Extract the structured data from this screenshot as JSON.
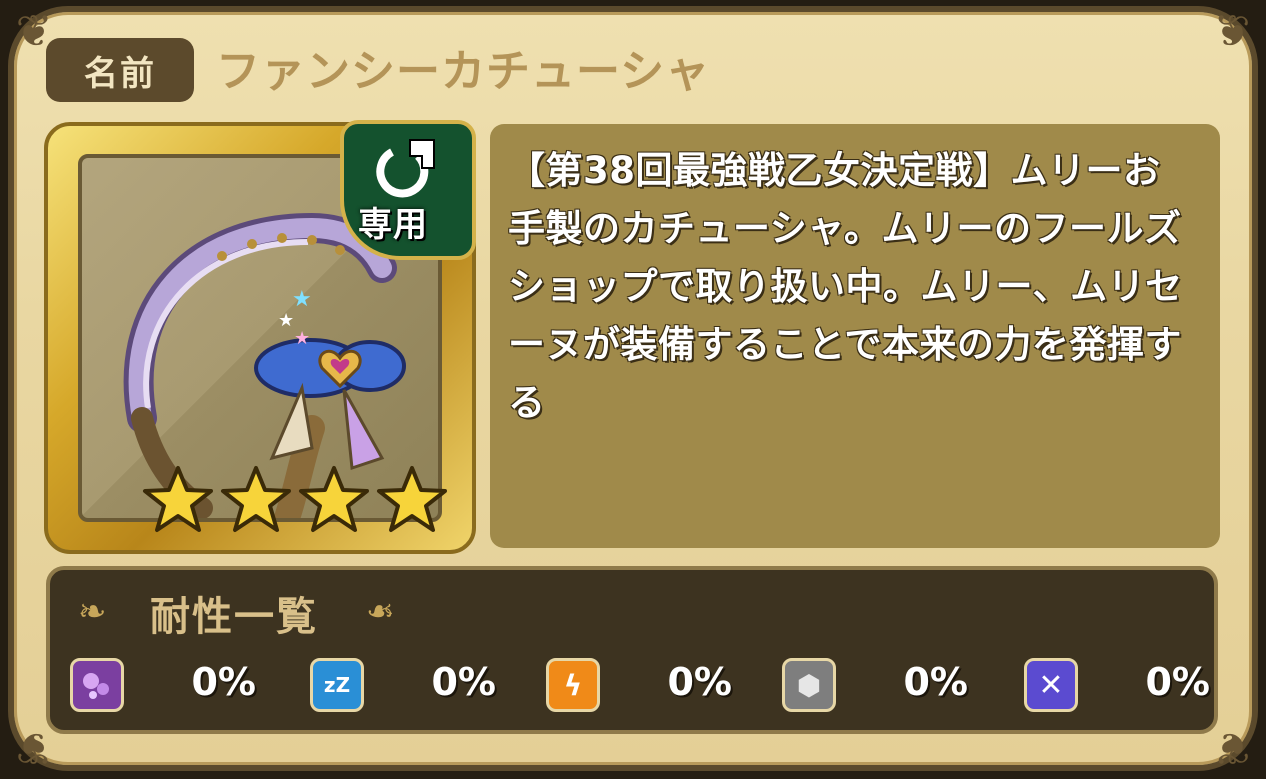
{
  "header": {
    "name_label": "名前",
    "item_name": "ファンシーカチューシャ"
  },
  "item": {
    "icon": "headband-icon",
    "exclusive_label": "専用",
    "stars": 4,
    "description": "【第38回最強戦乙女決定戦】ムリーお手製のカチューシャ。ムリーのフールズショップで取り扱い中。ムリー、ムリセーヌが装備することで本来の力を発揮する"
  },
  "resistance": {
    "title": "耐性一覧",
    "items": [
      {
        "icon": "poison-icon",
        "color": "#7b3fa0",
        "value": "0%"
      },
      {
        "icon": "sleep-icon",
        "color": "#2a8fd6",
        "value": "0%"
      },
      {
        "icon": "paralysis-icon",
        "color": "#f08a18",
        "value": "0%"
      },
      {
        "icon": "petrify-icon",
        "color": "#7e7e7e",
        "value": "0%"
      },
      {
        "icon": "seal-icon",
        "color": "#5b4bd0",
        "value": "0%"
      }
    ]
  }
}
